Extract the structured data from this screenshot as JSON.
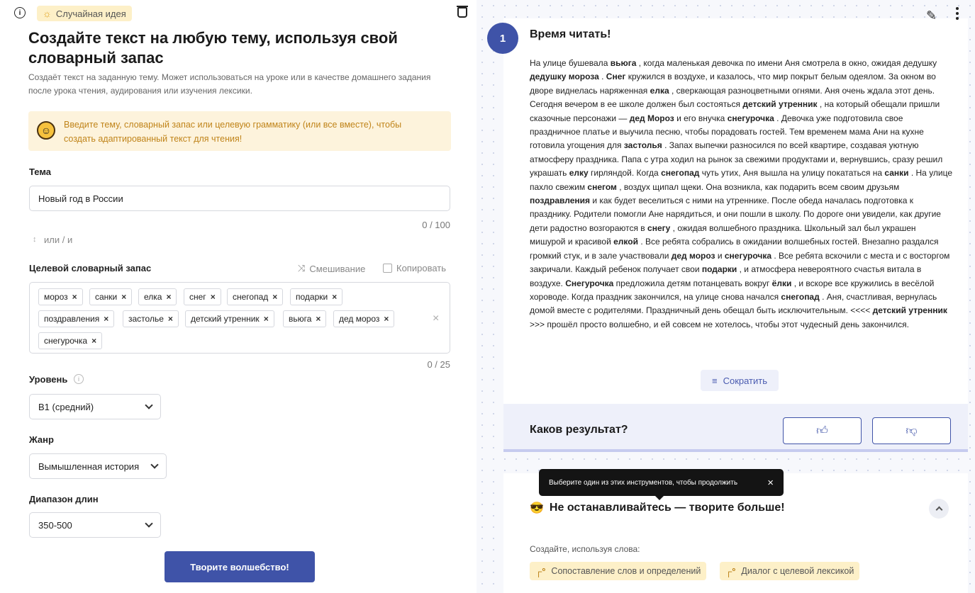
{
  "header": {
    "info_icon": "info-icon",
    "random_idea": "Случайная идея",
    "random_icon": "bulb-icon",
    "trash_icon": "trash-icon"
  },
  "intro": {
    "title": "Создайте текст на любую тему, используя свой словарный запас",
    "description": "Создаёт текст на заданную тему. Может использоваться на уроке или в качестве домашнего задания после урока чтения, аудирования или изучения лексики.",
    "hint": "Введите тему, словарный запас или целевую грамматику (или все вместе), чтобы создать адаптированный текст для чтения!"
  },
  "topic": {
    "label": "Тема",
    "value": "Новый год в России",
    "counter": "0 / 100"
  },
  "or_text": "или / и",
  "vocabulary": {
    "label": "Целевой словарный запас",
    "shuffle_label": "Смешивание",
    "copy_label": "Копировать",
    "tags": [
      "мороз",
      "санки",
      "елка",
      "снег",
      "снегопад",
      "подарки",
      "поздравления",
      "застолье",
      "детский утренник",
      "вьюга",
      "дед мороз",
      "снегурочка"
    ],
    "remove_symbol": "×",
    "clear_symbol": "×",
    "counter": "0 / 25"
  },
  "level": {
    "label": "Уровень",
    "help": "i",
    "value": "B1 (средний)"
  },
  "genre": {
    "label": "Жанр",
    "value": "Вымышленная история"
  },
  "length": {
    "label": "Диапазон длин",
    "value": "350-500"
  },
  "submit_label": "Творите волшебство!",
  "result": {
    "step": "1",
    "title": "Время читать!",
    "shorten_label": "Сократить"
  },
  "feedback": {
    "question": "Каков результат?",
    "like_icon": "thumbs-up-icon",
    "dislike_icon": "thumbs-down-icon"
  },
  "tooltip": {
    "text": "Выберите один из этих инструментов, чтобы продолжить",
    "close": "×"
  },
  "more": {
    "title": "Не останавливайтесь — творите больше!",
    "emoji": "😎",
    "create_label": "Создайте, используя слова:",
    "tools": [
      "Сопоставление слов и определений",
      "Диалог с целевой лексикой"
    ]
  },
  "colors": {
    "accent": "#3f53a8",
    "highlight": "#fdf0c8",
    "hint_text": "#c0841a"
  }
}
